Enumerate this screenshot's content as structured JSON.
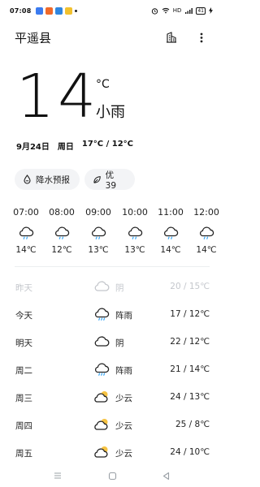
{
  "status": {
    "time": "07:08",
    "network": "HD",
    "battery": "41"
  },
  "header": {
    "location": "平遥县"
  },
  "current": {
    "temp": "14",
    "unit": "°C",
    "condition": "小雨",
    "date": "9月24日",
    "weekday": "周日",
    "range": "17°C / 12°C"
  },
  "chips": {
    "rain": "降水预报",
    "aqi": "优 39"
  },
  "hourly": [
    {
      "time": "07:00",
      "temp": "14℃",
      "icon": "cloud-drizzle-icon"
    },
    {
      "time": "08:00",
      "temp": "12℃",
      "icon": "cloud-drizzle-icon"
    },
    {
      "time": "09:00",
      "temp": "13℃",
      "icon": "cloud-drizzle-icon"
    },
    {
      "time": "10:00",
      "temp": "13℃",
      "icon": "cloud-drizzle-icon"
    },
    {
      "time": "11:00",
      "temp": "14℃",
      "icon": "cloud-drizzle-icon"
    },
    {
      "time": "12:00",
      "temp": "14℃",
      "icon": "cloud-drizzle-icon"
    }
  ],
  "daily": [
    {
      "day": "昨天",
      "condition": "阴",
      "range": "20 / 15℃",
      "icon": "cloud-icon",
      "past": true
    },
    {
      "day": "今天",
      "condition": "阵雨",
      "range": "17 / 12℃",
      "icon": "cloud-rain-icon"
    },
    {
      "day": "明天",
      "condition": "阴",
      "range": "22 / 12℃",
      "icon": "cloud-icon"
    },
    {
      "day": "周二",
      "condition": "阵雨",
      "range": "21 / 14℃",
      "icon": "cloud-rain-icon"
    },
    {
      "day": "周三",
      "condition": "少云",
      "range": "24 / 13℃",
      "icon": "partly-cloudy-icon"
    },
    {
      "day": "周四",
      "condition": "少云",
      "range": "25 / 8℃",
      "icon": "partly-cloudy-icon"
    },
    {
      "day": "周五",
      "condition": "少云",
      "range": "24 / 10℃",
      "icon": "partly-cloudy-icon"
    }
  ],
  "colors": {
    "sun": "#f6c343",
    "rain": "#3fa9f5",
    "icon_stroke": "#222222",
    "chip_bg": "#f3f4f6"
  }
}
